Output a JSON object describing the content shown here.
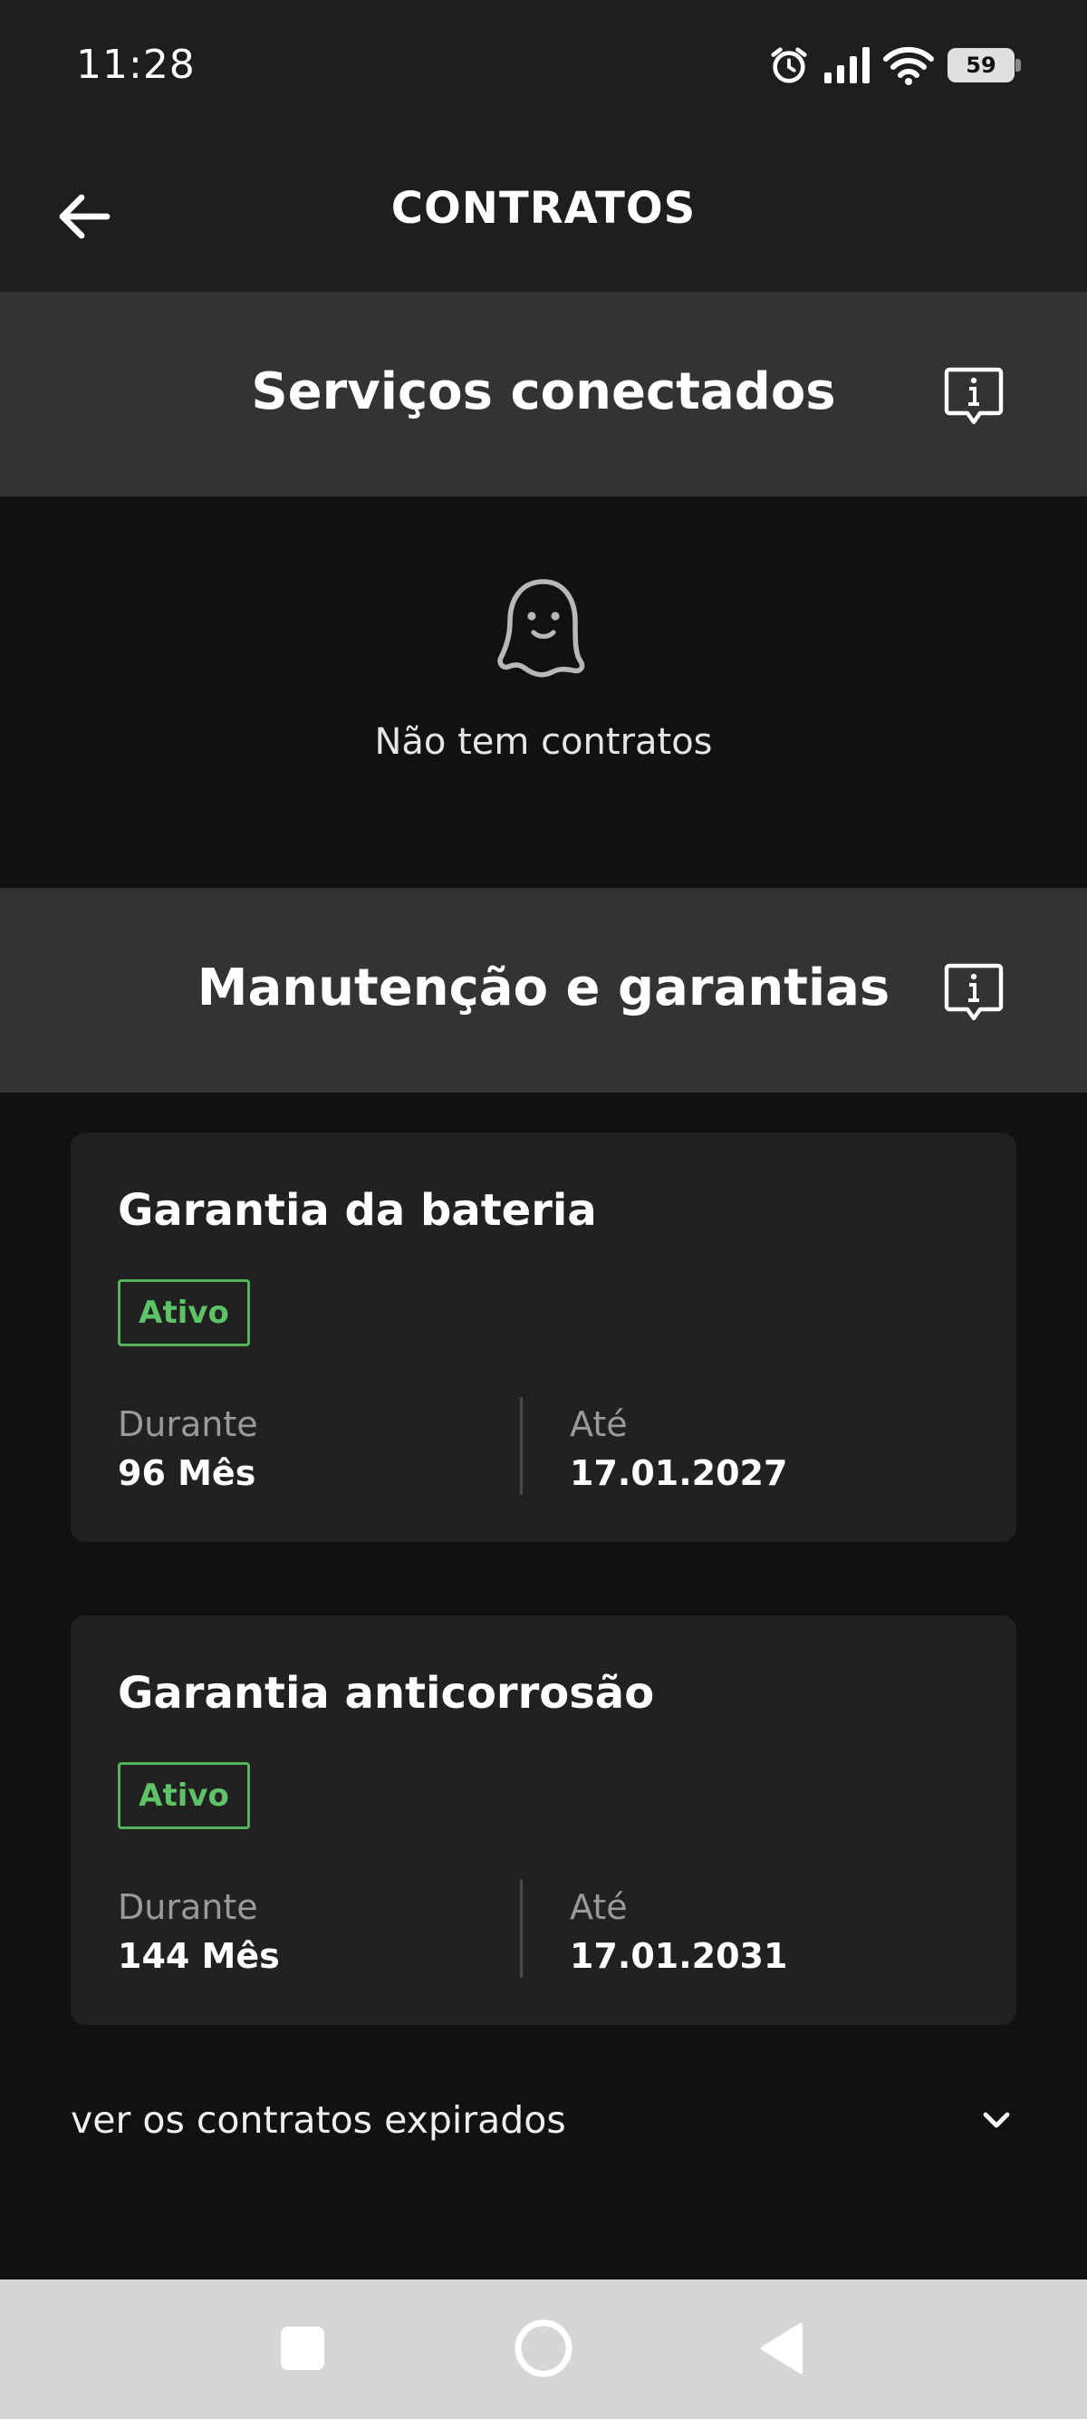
{
  "status_bar": {
    "time": "11:28",
    "battery": "59",
    "icons": [
      "alarm-icon",
      "signal-icon",
      "wifi-icon",
      "battery-icon"
    ]
  },
  "app_bar": {
    "title": "CONTRATOS",
    "back_icon": "arrow-left-icon"
  },
  "connected_services": {
    "title": "Serviços conectados",
    "info_icon": "info-icon",
    "empty_icon": "ghost-icon",
    "empty_text": "Não tem contratos"
  },
  "maintenance": {
    "title": "Manutenção e garantias",
    "info_icon": "info-icon",
    "contracts": [
      {
        "title": "Garantia da bateria",
        "status": "Ativo",
        "duration_label": "Durante",
        "duration_value": "96 Mês",
        "until_label": "Até",
        "until_value": "17.01.2027"
      },
      {
        "title": "Garantia anticorrosão",
        "status": "Ativo",
        "duration_label": "Durante",
        "duration_value": "144 Mês",
        "until_label": "Até",
        "until_value": "17.01.2031"
      }
    ]
  },
  "expired": {
    "label": "ver os contratos expirados",
    "icon": "chevron-down-icon"
  },
  "nav_bar": {
    "icons": [
      "recents-icon",
      "home-icon",
      "back-icon"
    ]
  },
  "colors": {
    "background": "#111111",
    "header_bg": "#1e1e1e",
    "section_bg": "#333333",
    "card_bg": "#212121",
    "active_green": "#5ec266"
  }
}
